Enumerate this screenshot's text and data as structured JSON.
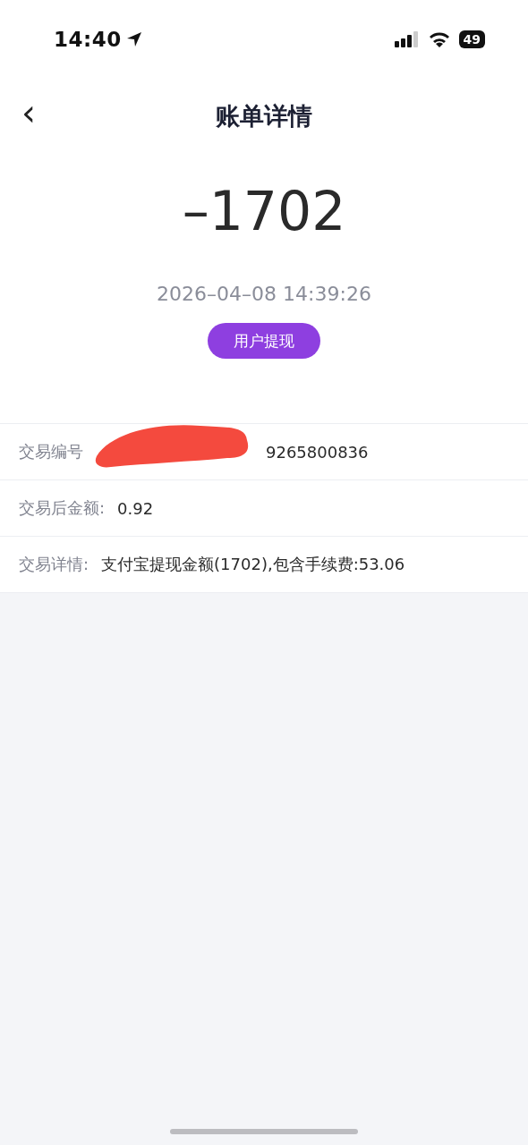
{
  "status_bar": {
    "time": "14:40",
    "battery": "49"
  },
  "nav": {
    "back": "‹",
    "title": "账单详情"
  },
  "summary": {
    "amount": "–1702",
    "datetime": "2026–04–08 14:39:26",
    "tag": "用户提现"
  },
  "details": [
    {
      "label": "交易编号",
      "value": "9265800836",
      "redacted": true
    },
    {
      "label": "交易后金额:",
      "value": "0.92",
      "redacted": false
    },
    {
      "label": "交易详情:",
      "value": "支付宝提现金额(1702),包含手续费:53.06",
      "redacted": false
    }
  ]
}
